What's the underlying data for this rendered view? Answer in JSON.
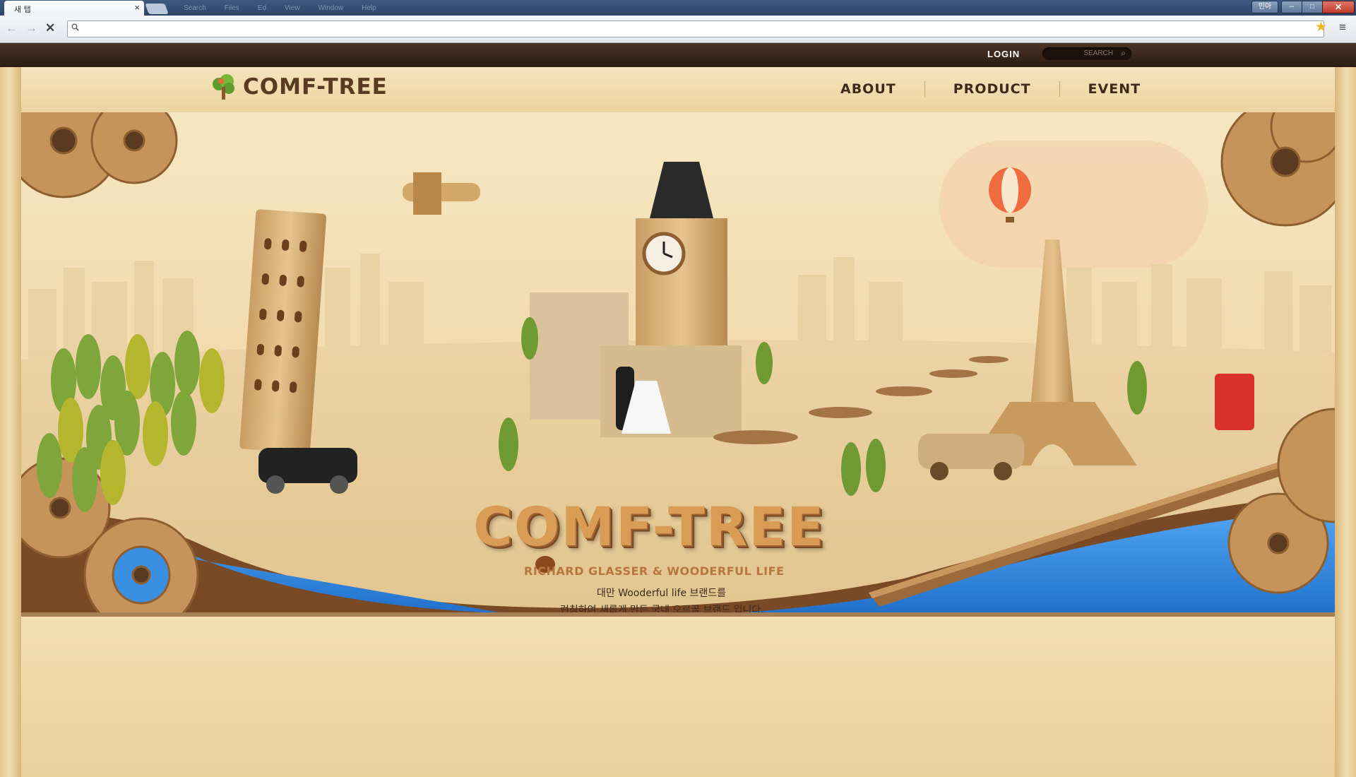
{
  "browser": {
    "tab_title": "새 탭",
    "tab_close": "×",
    "menu_hints": [
      "Search",
      "Files",
      "Ed",
      "View",
      "Window",
      "Help"
    ],
    "window_user": "민아",
    "window_min": "‒",
    "window_max": "□",
    "window_close": "✕",
    "nav_back": "←",
    "nav_forward": "→",
    "nav_stop": "✕",
    "address_value": "",
    "address_icon": "search-icon",
    "star_glyph": "★",
    "menu_glyph": "≡"
  },
  "site": {
    "login": "LOGIN",
    "search_placeholder": "SEARCH",
    "search_glyph": "⌕",
    "logo": "COMF-TREE",
    "menu": [
      {
        "label": "ABOUT"
      },
      {
        "label": "PRODUCT"
      },
      {
        "label": "EVENT"
      }
    ],
    "hero": {
      "title": "COMF-TREE",
      "subtitle": "RICHARD GLASSER & WOODERFUL LIFE",
      "description_line1": "대만 Wooderful life 브랜드를",
      "description_line2": "런칭하여 새롭게 만든 국내 오르골 브랜드 입니다."
    },
    "colors": {
      "wood_dark": "#3e2a1a",
      "wood_light": "#ecd39f",
      "water": "#2f86de",
      "title_orange": "#d89c55"
    }
  }
}
